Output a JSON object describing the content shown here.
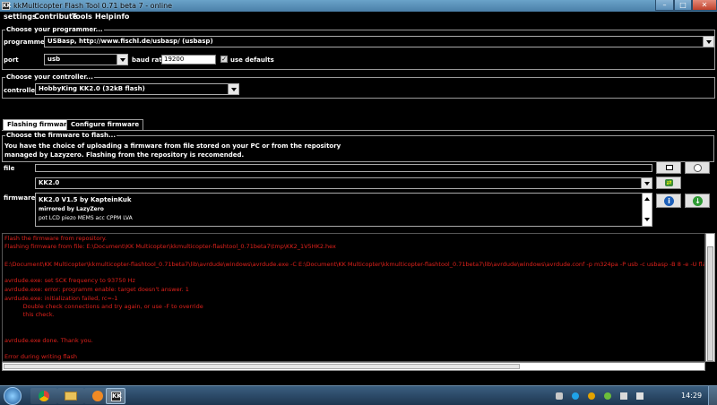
{
  "window": {
    "title": "kkMulticopter Flash Tool 0.71 beta 7 - online",
    "app_icon": "KK"
  },
  "menu": [
    "settings",
    "Contribute",
    "Tools",
    "Help",
    "info"
  ],
  "programmer_panel": {
    "legend": "Choose your programmer...",
    "programmer_label": "programmer",
    "programmer_value": "USBasp, http://www.fischl.de/usbasp/ (usbasp)",
    "port_label": "port",
    "port_value": "usb",
    "baud_label": "baud rate",
    "baud_value": "19200",
    "use_defaults_label": "use defaults",
    "use_defaults_checked": true
  },
  "controller_panel": {
    "legend": "Choose your controller...",
    "controller_label": "controller",
    "controller_value": "HobbyKing KK2.0 (32kB flash)"
  },
  "tabs": [
    "Flashing firmware",
    "Configure firmware"
  ],
  "firmware_panel": {
    "legend": "Choose the firmware to flash...",
    "desc_line1": "You have the choice of uploading a firmware from file stored on your PC or from the repository",
    "desc_line2": "managed by Lazyzero. Flashing from the repository is recomended.",
    "file_label": "file",
    "firmware_label": "firmware",
    "firmware_select": "KK2.0",
    "firmware_title": "KK2.0 V1.5  by KapteinKuk",
    "mirrored_by": "mirrored by LazyZero",
    "features": "pot  LCD  piezo  MEMS  acc  CPPM  LVA"
  },
  "log_lines": [
    "Flash the firmware from repository.",
    "Flashing firmware from file:  E:\\Document\\KK Multicopter\\kkmulticopter-flashtool_0.71beta7\\tmp\\KK2_1V5HK2.hex",
    "",
    "E:\\Document\\KK Multicopter\\kkmulticopter-flashtool_0.71beta7\\lib\\avrdude\\windows\\avrdude.exe -C E:\\Document\\KK Multicopter\\kkmulticopter-flashtool_0.71beta7\\lib\\avrdude\\windows\\avrdude.conf -p m324pa -P usb -c usbasp -B 8 -e -U flash:w:E:\\",
    "",
    "avrdude.exe: set SCK frequency to 93750 Hz",
    "avrdude.exe: error: programm enable: target doesn't answer. 1",
    "avrdude.exe: initialization failed, rc=-1",
    "          Double check connections and try again, or use -F to override",
    "          this check.",
    "",
    "",
    "avrdude.exe done.  Thank you.",
    "",
    "",
    "Error during writing flash"
  ],
  "taskbar": {
    "time": "14:29"
  },
  "icons": {
    "minimize": "minimize-icon",
    "maximize": "maximize-icon",
    "close": "close-icon",
    "browse": "monitor-icon",
    "record": "record-icon",
    "refresh": "refresh-icon",
    "info": "info-icon",
    "download": "download-icon",
    "start": "windows-start-icon"
  }
}
